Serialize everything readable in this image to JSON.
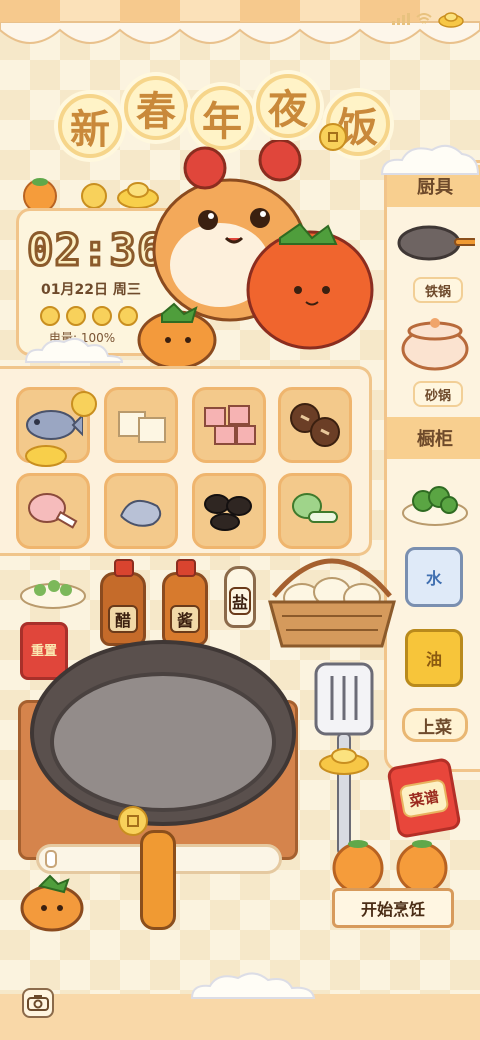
{
  "app": {
    "title_chars": [
      "新",
      "春",
      "年",
      "夜",
      "饭"
    ]
  },
  "status": {
    "signal_icon": "signal-icon",
    "wifi_icon": "wifi-icon"
  },
  "clock": {
    "time": "02:36",
    "date": "01月22日 周三",
    "battery_label": "电量: 100%"
  },
  "side": {
    "cookware_header": "厨具",
    "cookware": [
      {
        "label": "铁锅",
        "icon": "iron-wok-icon"
      },
      {
        "label": "砂锅",
        "icon": "clay-pot-icon"
      }
    ],
    "cabinet_header": "橱柜",
    "cabinet": [
      {
        "label": "水",
        "icon": "water-bottle-icon"
      },
      {
        "label": "油",
        "icon": "oil-bottle-icon"
      }
    ],
    "serve_label": "上菜",
    "recipe_label": "菜谱"
  },
  "shelf": {
    "ingredients": [
      {
        "name": "fish",
        "icon": "fish-icon"
      },
      {
        "name": "tofu",
        "icon": "tofu-icon"
      },
      {
        "name": "pork-belly",
        "icon": "pork-belly-icon"
      },
      {
        "name": "shiitake",
        "icon": "shiitake-icon"
      },
      {
        "name": "chicken-leg",
        "icon": "chicken-leg-icon"
      },
      {
        "name": "shrimp",
        "icon": "shrimp-icon"
      },
      {
        "name": "black-fungus",
        "icon": "black-fungus-icon"
      },
      {
        "name": "bok-choy",
        "icon": "bok-choy-icon"
      }
    ]
  },
  "condiments": {
    "vinegar": "醋",
    "soy_sauce": "酱",
    "salt": "盐"
  },
  "controls": {
    "reset_label": "重置",
    "start_label": "开始烹饪",
    "heat_level": 0
  },
  "colors": {
    "accent": "#f1c48a",
    "panel": "#fdf3df",
    "brand_red": "#e0463b"
  }
}
